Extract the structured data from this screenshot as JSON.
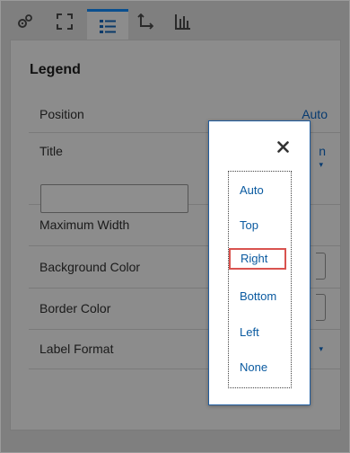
{
  "tabs": [
    {
      "icon": "gears-icon",
      "active": false
    },
    {
      "icon": "fullscreen-icon",
      "active": false
    },
    {
      "icon": "legend-list-icon",
      "active": true
    },
    {
      "icon": "axis-icon",
      "active": false
    },
    {
      "icon": "bar-chart-icon",
      "active": false
    }
  ],
  "legend": {
    "heading": "Legend",
    "rows": [
      {
        "label": "Position",
        "value": "Auto"
      },
      {
        "label": "Title",
        "value": "n"
      },
      {
        "label": "Maximum Width"
      },
      {
        "label": "Background Color"
      },
      {
        "label": "Border Color"
      },
      {
        "label": "Label Format"
      }
    ]
  },
  "popup": {
    "close_label": "×",
    "options": [
      "Auto",
      "Top",
      "Right",
      "Bottom",
      "Left",
      "None"
    ],
    "selected": "Right"
  },
  "colors": {
    "accent": "#0a5aa0",
    "selection_border": "#d9534f",
    "popup_border": "#1f5c9e"
  }
}
